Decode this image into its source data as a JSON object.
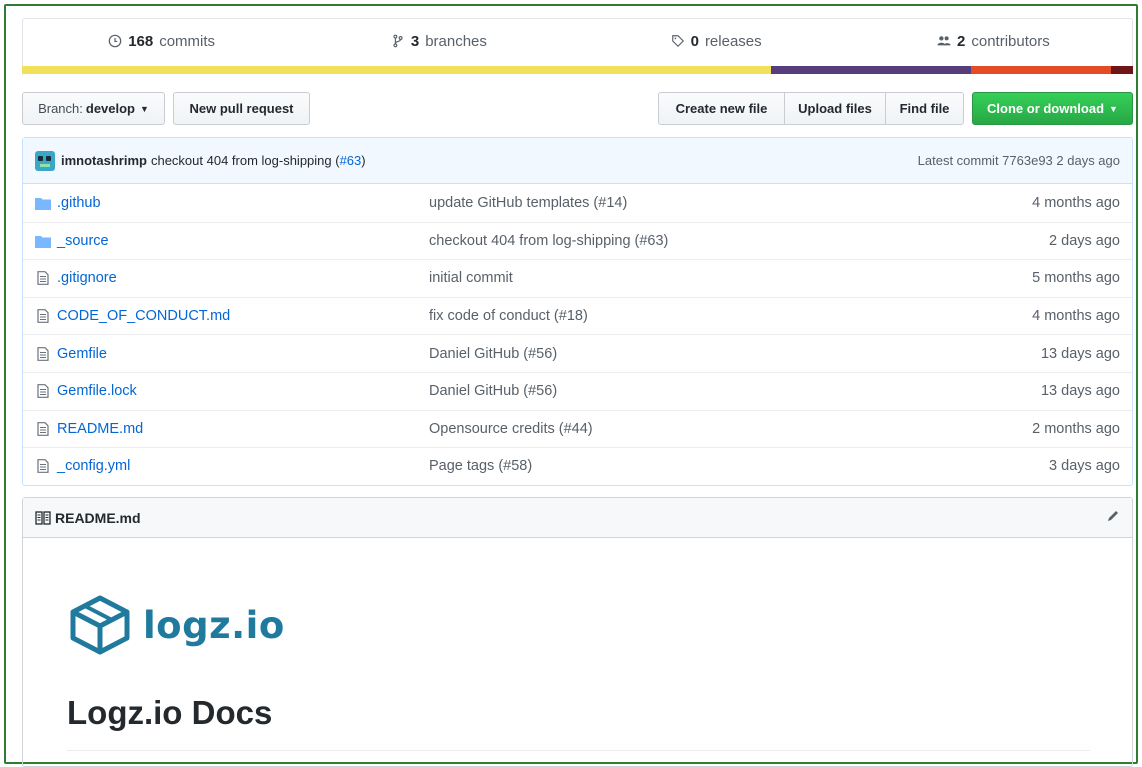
{
  "summary": {
    "commits": {
      "count": "168",
      "label": "commits",
      "icon": "history-icon"
    },
    "branches": {
      "count": "3",
      "label": "branches",
      "icon": "git-branch-icon"
    },
    "releases": {
      "count": "0",
      "label": "releases",
      "icon": "tag-icon"
    },
    "contributors": {
      "count": "2",
      "label": "contributors",
      "icon": "people-icon"
    }
  },
  "language_bar": [
    {
      "color": "#f1e05a",
      "fraction": 0.674
    },
    {
      "color": "#563d7c",
      "fraction": 0.18
    },
    {
      "color": "#e34c26",
      "fraction": 0.126
    },
    {
      "color": "#701516",
      "fraction": 0.02
    }
  ],
  "toolbar": {
    "branch_prefix": "Branch:",
    "branch_name": "develop",
    "new_pull_request": "New pull request",
    "create_new_file": "Create new file",
    "upload_files": "Upload files",
    "find_file": "Find file",
    "clone_or_download": "Clone or download"
  },
  "latest_commit": {
    "author": "imnotashrimp",
    "message": "checkout 404 from log-shipping (",
    "pr": "#63",
    "message_end": ")",
    "right": "Latest commit 7763e93 2 days ago"
  },
  "files": [
    {
      "name": ".github",
      "type": "folder",
      "message": "update GitHub templates (#14)",
      "age": "4 months ago"
    },
    {
      "name": "_source",
      "type": "folder",
      "message": "checkout 404 from log-shipping (#63)",
      "age": "2 days ago"
    },
    {
      "name": ".gitignore",
      "type": "file",
      "message": "initial commit",
      "age": "5 months ago"
    },
    {
      "name": "CODE_OF_CONDUCT.md",
      "type": "file",
      "message": "fix code of conduct (#18)",
      "age": "4 months ago"
    },
    {
      "name": "Gemfile",
      "type": "file",
      "message": "Daniel GitHub (#56)",
      "age": "13 days ago"
    },
    {
      "name": "Gemfile.lock",
      "type": "file",
      "message": "Daniel GitHub (#56)",
      "age": "13 days ago"
    },
    {
      "name": "README.md",
      "type": "file",
      "message": "Opensource credits (#44)",
      "age": "2 months ago"
    },
    {
      "name": "_config.yml",
      "type": "file",
      "message": "Page tags (#58)",
      "age": "3 days ago"
    }
  ],
  "readme": {
    "header": "README.md",
    "logo_text": "logz.io",
    "title": "Logz.io Docs"
  }
}
